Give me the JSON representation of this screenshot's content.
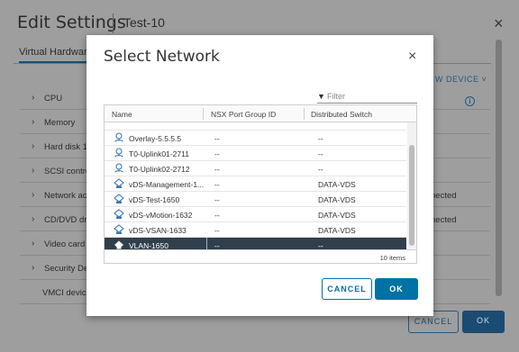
{
  "edit_settings": {
    "title": "Edit Settings",
    "vm_name": "Test-10",
    "close": "×",
    "tab": "Virtual Hardware",
    "add_device": "W DEVICE ˅",
    "rows": [
      {
        "chevron": "›",
        "label": "CPU",
        "value": ""
      },
      {
        "chevron": "›",
        "label": "Memory",
        "value": ""
      },
      {
        "chevron": "›",
        "label": "Hard disk 1",
        "value": ""
      },
      {
        "chevron": "›",
        "label": "SCSI contro",
        "value": ""
      },
      {
        "chevron": "›",
        "label": "Network ac",
        "value": "nected"
      },
      {
        "chevron": "›",
        "label": "CD/DVD dr",
        "value": "nected"
      },
      {
        "chevron": "›",
        "label": "Video card",
        "value": ""
      },
      {
        "chevron": "›",
        "label": "Security De",
        "value": ""
      },
      {
        "chevron": "",
        "label": "VMCI device",
        "value": ""
      }
    ],
    "cancel_label": "CANCEL",
    "ok_label": "OK"
  },
  "select_network": {
    "title": "Select Network",
    "close": "×",
    "filter_icon": "▼",
    "filter_placeholder": "Filter",
    "columns": [
      "Name",
      "NSX Port Group ID",
      "Distributed Switch"
    ],
    "rows": [
      {
        "icon": "network-icon",
        "name": "Overlay-5.5.5.5",
        "nsx_id": "--",
        "switch": "--",
        "selected": false
      },
      {
        "icon": "network-icon",
        "name": "T0-Uplink01-2711",
        "nsx_id": "--",
        "switch": "--",
        "selected": false
      },
      {
        "icon": "network-icon",
        "name": "T0-Uplink02-2712",
        "nsx_id": "--",
        "switch": "--",
        "selected": false
      },
      {
        "icon": "dvs-portgroup-icon",
        "name": "vDS-Management-1...",
        "nsx_id": "--",
        "switch": "DATA-VDS",
        "selected": false
      },
      {
        "icon": "dvs-portgroup-icon",
        "name": "vDS-Test-1650",
        "nsx_id": "--",
        "switch": "DATA-VDS",
        "selected": false
      },
      {
        "icon": "dvs-portgroup-icon",
        "name": "vDS-vMotion-1632",
        "nsx_id": "--",
        "switch": "DATA-VDS",
        "selected": false
      },
      {
        "icon": "dvs-portgroup-icon",
        "name": "vDS-VSAN-1633",
        "nsx_id": "--",
        "switch": "DATA-VDS",
        "selected": false
      },
      {
        "icon": "network-icon",
        "name": "VLAN-1650",
        "nsx_id": "--",
        "switch": "--",
        "selected": true
      }
    ],
    "item_count": "10 items",
    "cancel_label": "CANCEL",
    "ok_label": "OK"
  },
  "colors": {
    "primary": "#0072a3",
    "selected_row": "#313f4c",
    "overlay": "#9e9e9e"
  }
}
